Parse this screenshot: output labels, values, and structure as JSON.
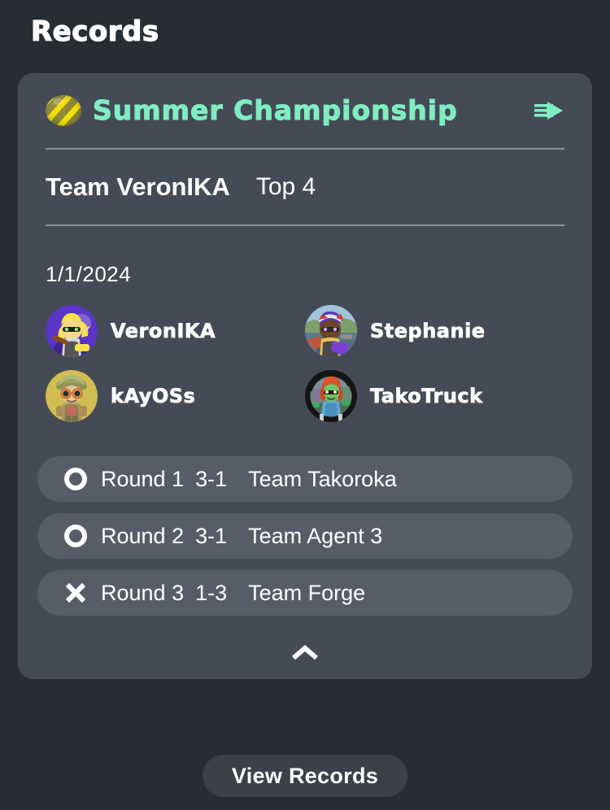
{
  "page": {
    "title": "Records",
    "background_color": "#282c34"
  },
  "record_card": {
    "background_color": "#454b56",
    "badge_icon": "striped-medal-icon",
    "event_name": "Summer Championship",
    "event_name_color": "#7fedc1",
    "forward_arrow_icon": "arrow-right-icon",
    "team_name": "Team VeronIKA",
    "placement": "Top 4",
    "date": "1/1/2024",
    "players": [
      {
        "name": "VeronIKA",
        "avatar": "inkling-blonde-purple-avatar"
      },
      {
        "name": "Stephanie",
        "avatar": "octoling-purple-hair-avatar"
      },
      {
        "name": "kAyOSs",
        "avatar": "explorer-hat-gold-avatar"
      },
      {
        "name": "TakoTruck",
        "avatar": "octoling-red-hair-dark-avatar"
      }
    ],
    "rounds": [
      {
        "result": "win",
        "result_icon": "circle-o-icon",
        "label": "Round 1",
        "score": "3-1",
        "opponent": "Team Takoroka"
      },
      {
        "result": "win",
        "result_icon": "circle-o-icon",
        "label": "Round 2",
        "score": "3-1",
        "opponent": "Team Agent 3"
      },
      {
        "result": "loss",
        "result_icon": "cross-x-icon",
        "label": "Round 3",
        "score": "1-3",
        "opponent": "Team Forge"
      }
    ],
    "collapse_icon": "chevron-up-icon",
    "round_pill_color": "#575d68"
  },
  "footer": {
    "view_records_label": "View Records"
  }
}
